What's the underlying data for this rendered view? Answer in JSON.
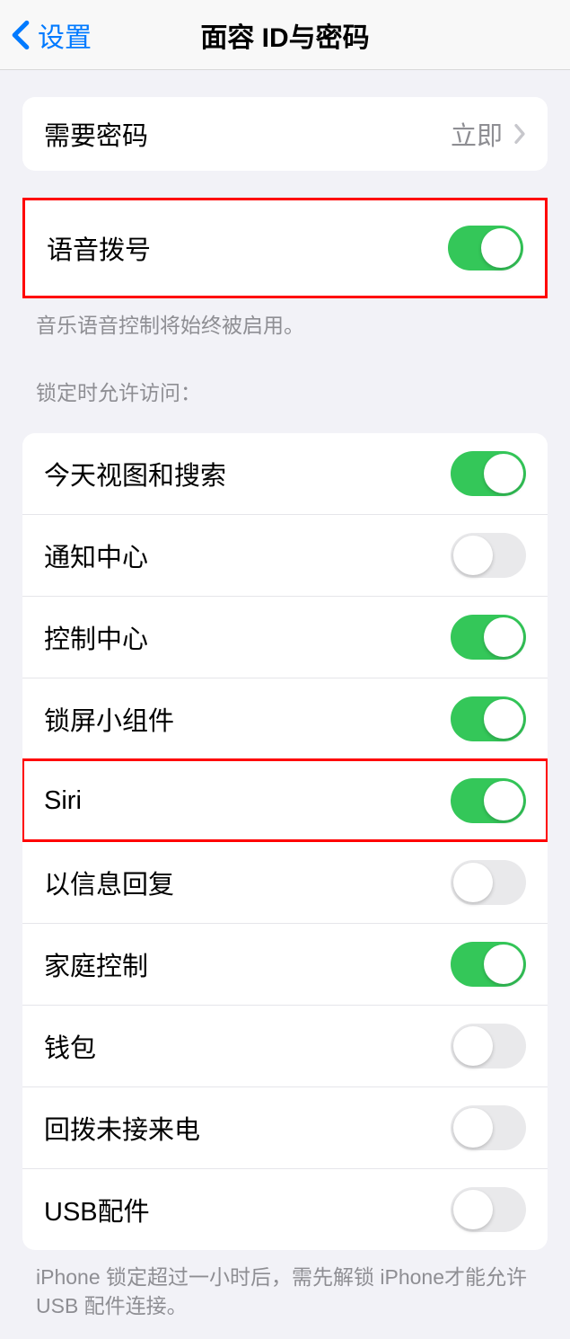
{
  "nav": {
    "back_label": "设置",
    "title": "面容 ID与密码"
  },
  "passcode_required": {
    "label": "需要密码",
    "value": "立即"
  },
  "voice_dial": {
    "label": "语音拨号",
    "footer": "音乐语音控制将始终被启用。"
  },
  "lockscreen_header": "锁定时允许访问：",
  "lockscreen_items": {
    "today_search": "今天视图和搜索",
    "notification_center": "通知中心",
    "control_center": "控制中心",
    "lockscreen_widgets": "锁屏小组件",
    "siri": "Siri",
    "reply_message": "以信息回复",
    "home_control": "家庭控制",
    "wallet": "钱包",
    "return_missed": "回拨未接来电",
    "usb": "USB配件"
  },
  "lockscreen_footer": "iPhone 锁定超过一小时后，需先解锁 iPhone才能允许USB 配件连接。",
  "toggles": {
    "voice_dial": true,
    "today_search": true,
    "notification_center": false,
    "control_center": true,
    "lockscreen_widgets": true,
    "siri": true,
    "reply_message": false,
    "home_control": true,
    "wallet": false,
    "return_missed": false,
    "usb": false
  }
}
